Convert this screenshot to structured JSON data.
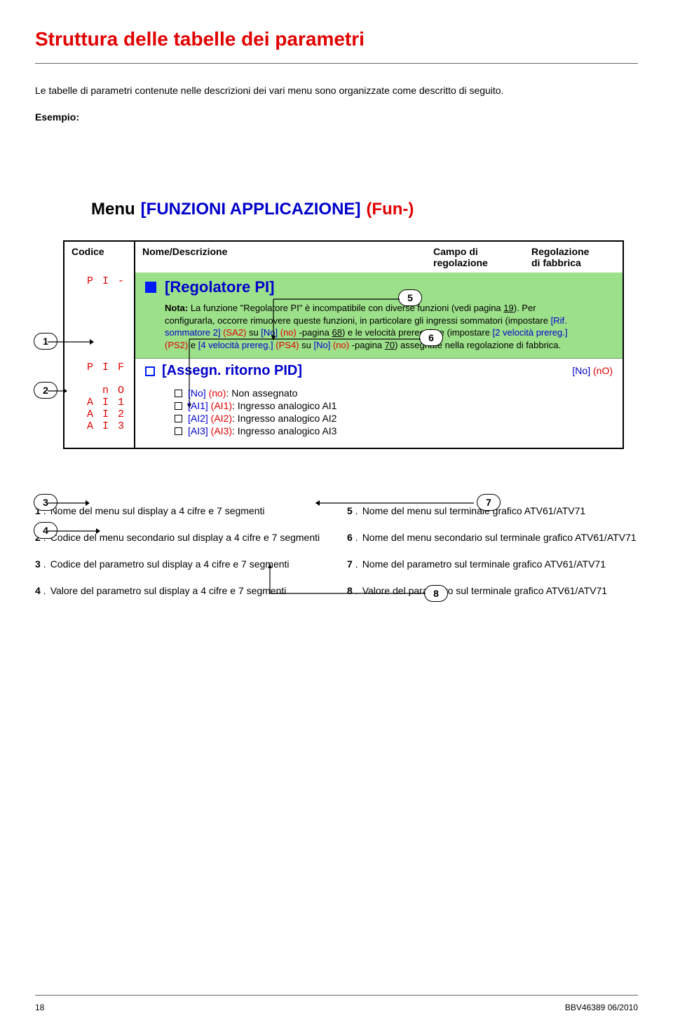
{
  "title": "Struttura delle tabelle dei parametri",
  "intro": "Le tabelle di parametri contenute nelle descrizioni dei vari menu sono organizzate come descritto di seguito.",
  "esempio": "Esempio:",
  "menu": {
    "label": "Menu",
    "blue": "[FUNZIONI APPLICAZIONE]",
    "red": "(Fun-)"
  },
  "headers": {
    "codice": "Codice",
    "nome": "Nome/Descrizione",
    "campo_line1": "Campo di",
    "campo_line2": "regolazione",
    "reg_line1": "Regolazione",
    "reg_line2": "di fabbrica"
  },
  "codes": {
    "pi_menu": "P I -",
    "pif": "P I F",
    "no": "n O",
    "ai1": "A I 1",
    "ai2": "A I 2",
    "ai3": "A I 3"
  },
  "regpi": "[Regolatore PI]",
  "note": {
    "lead": "Nota:",
    "l1a": " La funzione \"Regolatore PI\" è incompatibile con diverse funzioni (vedi pagina ",
    "p19": "19",
    "l1b": "). Per",
    "l2a": "configurarla, occorre rimuovere queste funzioni, in particolare gli ingressi sommatori (impostare ",
    "rif": "[Rif.",
    "l3a": "sommatore 2]",
    "sa2": " (SA2)",
    "su1": " su ",
    "no_blue": "[No]",
    "no_red": " (no)",
    "pag68a": " -pagina ",
    "p68": "68",
    "l3b": ") e le velocità preregolate (impostare ",
    "vel2": "[2 velocità prereg.]",
    "ps2": "(PS2)",
    "e": " e ",
    "vel4": "[4 velocità prereg.]",
    "ps4": " (PS4)",
    "su2": " su ",
    "pag70a": " -pagina ",
    "p70": "70",
    "l4b": ") assegnate nella regolazione di fabbrica."
  },
  "assegn": "[Assegn. ritorno PID]",
  "default_no": "[No] (nO)",
  "opts": {
    "o1": "[No] (no): Non assegnato",
    "o1_blue": "[No]",
    "o1_red": " (no)",
    "o1_rest": ": Non assegnato",
    "o2_blue": "[AI1]",
    "o2_red": " (AI1)",
    "o2_rest": ": Ingresso analogico AI1",
    "o3_blue": "[AI2]",
    "o3_red": " (AI2)",
    "o3_rest": ": Ingresso analogico AI2",
    "o4_blue": "[AI3]",
    "o4_red": " (AI3)",
    "o4_rest": ": Ingresso analogico AI3"
  },
  "badges": {
    "b1": "1",
    "b2": "2",
    "b3": "3",
    "b4": "4",
    "b5": "5",
    "b6": "6",
    "b7": "7",
    "b8": "8"
  },
  "legend": {
    "r1": "Nome del menu sul display a 4 cifre e 7 segmenti",
    "r2": "Codice del menu secondario sul display a 4 cifre e 7 segmenti",
    "r3": "Codice del parametro sul display a 4 cifre e 7 segmenti",
    "r4": "Valore del parametro sul display a 4 cifre e 7 segmenti",
    "r5": "Nome del menu sul terminale grafico ATV61/ATV71",
    "r6": "Nome del menu secondario sul terminale grafico ATV61/ATV71",
    "r7": "Nome del parametro sul terminale grafico ATV61/ATV71",
    "r8": "Valore del parametro sul terminale grafico ATV61/ATV71"
  },
  "footer": {
    "page": "18",
    "doc": "BBV46389  06/2010"
  }
}
